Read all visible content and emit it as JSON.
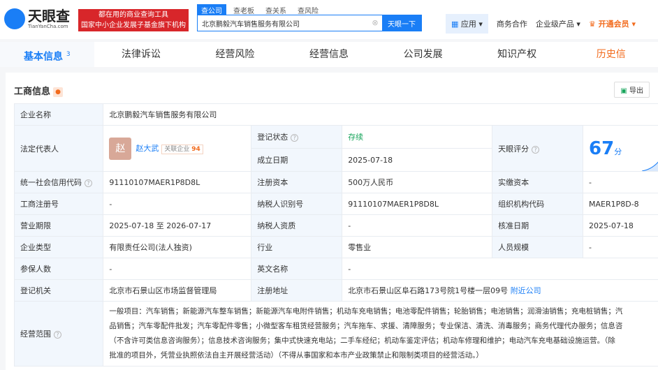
{
  "header": {
    "logo": "天眼查",
    "logo_sub": "TianYanCha.com",
    "slogan1": "都在用的商业查询工具",
    "slogan2": "国家中小企业发展子基金旗下机构",
    "search_tabs": [
      "查公司",
      "查老板",
      "查关系",
      "查风险"
    ],
    "search_value": "北京鹏毅汽车销售服务有限公司",
    "search_button": "天眼一下",
    "nav": {
      "app": "应用",
      "biz": "商务合作",
      "enterprise": "企业级产品",
      "vip": "开通会员"
    }
  },
  "tabs": [
    {
      "label": "基本信息",
      "badge": "3"
    },
    {
      "label": "法律诉讼"
    },
    {
      "label": "经营风险"
    },
    {
      "label": "经营信息"
    },
    {
      "label": "公司发展"
    },
    {
      "label": "知识产权"
    },
    {
      "label": "历史信"
    }
  ],
  "section": {
    "title": "工商信息",
    "export": "导出"
  },
  "info": {
    "company_name_label": "企业名称",
    "company_name": "北京鹏毅汽车销售服务有限公司",
    "legal_rep_label": "法定代表人",
    "legal_rep_avatar": "赵",
    "legal_rep": "赵大武",
    "related_label": "关联企业",
    "related_count": "94",
    "reg_status_label": "登记状态",
    "reg_status": "存续",
    "est_date_label": "成立日期",
    "est_date": "2025-07-18",
    "score_label": "天眼评分",
    "score": "67",
    "score_unit": "分",
    "credit_code_label": "统一社会信用代码",
    "credit_code": "91110107MAER1P8D8L",
    "reg_capital_label": "注册资本",
    "reg_capital": "500万人民币",
    "paid_capital_label": "实缴资本",
    "paid_capital": "-",
    "reg_no_label": "工商注册号",
    "reg_no": "-",
    "taxpayer_id_label": "纳税人识别号",
    "taxpayer_id": "91110107MAER1P8D8L",
    "org_code_label": "组织机构代码",
    "org_code": "MAER1P8D-8",
    "term_label": "营业期限",
    "term": "2025-07-18 至 2026-07-17",
    "taxpayer_q_label": "纳税人资质",
    "taxpayer_q": "-",
    "approval_label": "核准日期",
    "approval": "2025-07-18",
    "type_label": "企业类型",
    "type": "有限责任公司(法人独资)",
    "industry_label": "行业",
    "industry": "零售业",
    "staff_label": "人员规模",
    "staff": "-",
    "insured_label": "参保人数",
    "insured": "-",
    "en_name_label": "英文名称",
    "en_name": "-",
    "authority_label": "登记机关",
    "authority": "北京市石景山区市场监督管理局",
    "address_label": "注册地址",
    "address": "北京市石景山区阜石路173号院1号楼一层09号",
    "nearby": "附近公司",
    "scope_label": "经营范围",
    "scope_lines": [
      "一般项目：汽车销售；新能源汽车整车销售；新能源汽车电附件销售；机动车充电销售；电池零配件销售；轮胎销售；电池销售；润滑油销售；充电桩销售；汽",
      "品销售；汽车零配件批发；汽车零配件零售；小微型客车租赁经营服务；汽车拖车、求援、清障服务；专业保洁、清洗、消毒服务；商务代理代办服务；信息咨",
      "（不含许可类信息咨询服务）；信息技术咨询服务；集中式快速充电站；二手车经纪；机动车鉴定评估；机动车修理和维护；电动汽车充电基础设施运营。（除",
      "批准的项目外，凭营业执照依法自主开展经营活动）（不得从事国家和本市产业政策禁止和限制类项目的经营活动。）"
    ]
  }
}
